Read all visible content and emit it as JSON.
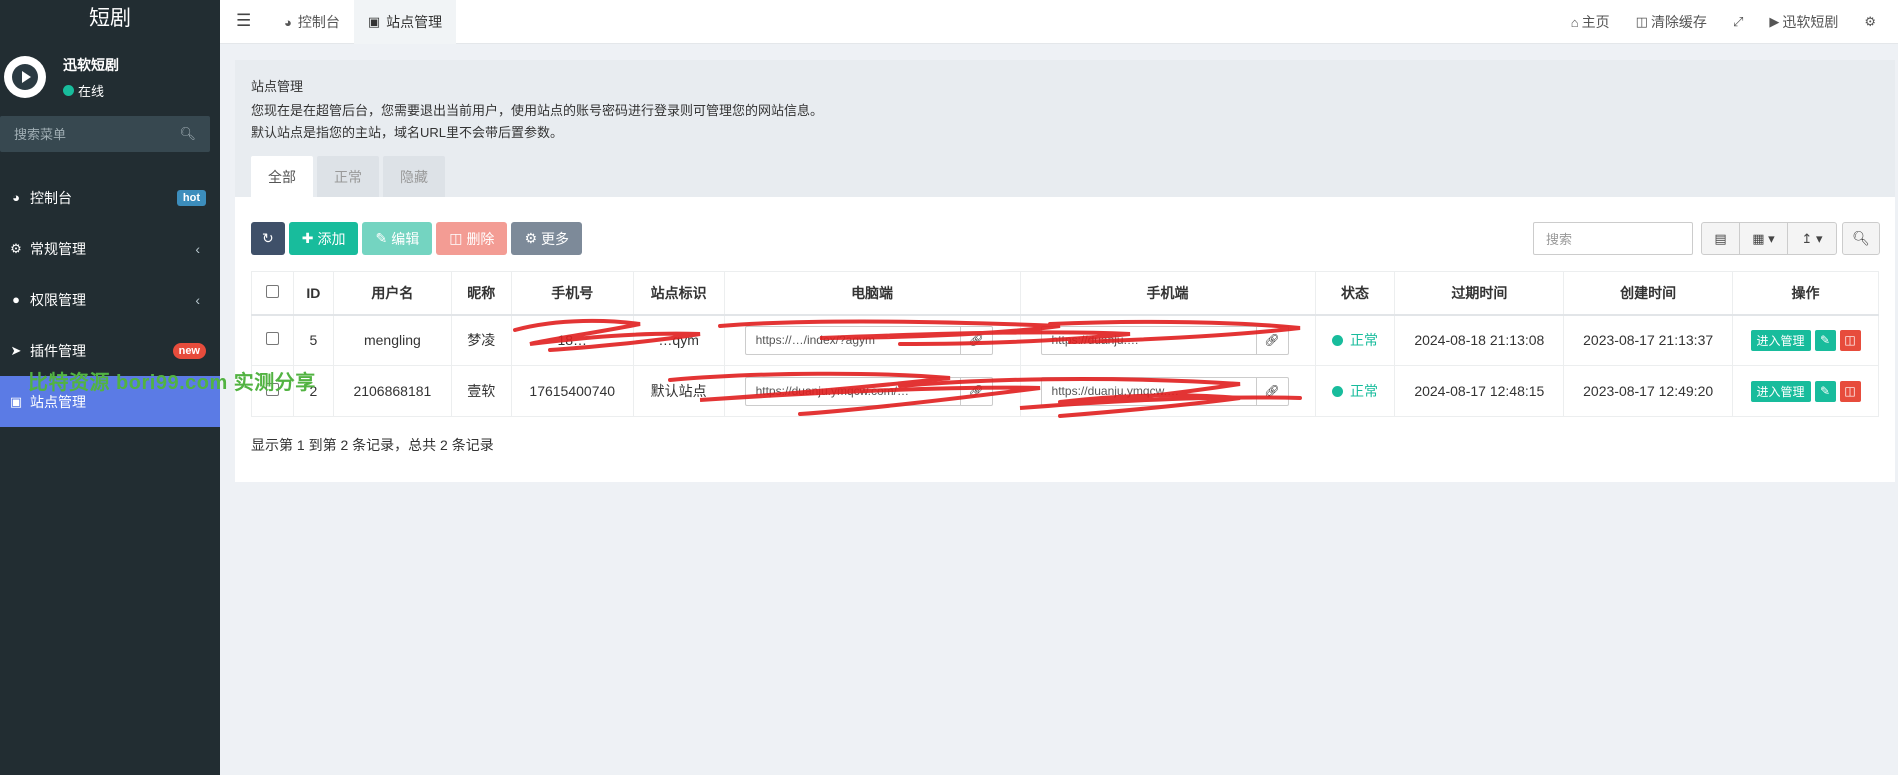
{
  "sidebar": {
    "brand": "短剧",
    "user": {
      "name": "迅软短剧",
      "status": "在线"
    },
    "search_placeholder": "搜索菜单",
    "items": [
      {
        "label": "控制台",
        "badge": "hot"
      },
      {
        "label": "常规管理"
      },
      {
        "label": "权限管理"
      },
      {
        "label": "插件管理",
        "badge": "new"
      },
      {
        "label": "站点管理"
      }
    ]
  },
  "watermark": "比特资源 bori99.com 实测分享",
  "topbar": {
    "tabs": [
      {
        "label": "控制台"
      },
      {
        "label": "站点管理"
      }
    ],
    "links": {
      "home": "主页",
      "clear_cache": "清除缓存",
      "user": "迅软短剧"
    }
  },
  "panel": {
    "title": "站点管理",
    "desc_line1": "您现在是在超管后台，您需要退出当前用户，使用站点的账号密码进行登录则可管理您的网站信息。",
    "desc_line2": "默认站点是指您的主站，域名URL里不会带后置参数。",
    "tabs": [
      "全部",
      "正常",
      "隐藏"
    ],
    "toolbar": {
      "add": "添加",
      "edit": "编辑",
      "delete": "删除",
      "more": "更多"
    },
    "search_placeholder": "搜索",
    "table": {
      "headers": [
        "ID",
        "用户名",
        "昵称",
        "手机号",
        "站点标识",
        "电脑端",
        "手机端",
        "状态",
        "过期时间",
        "创建时间",
        "操作"
      ],
      "rows": [
        {
          "id": "5",
          "username": "mengling",
          "nickname": "梦凌",
          "phone": "18…",
          "site": "…qym",
          "pc": "https://…/index/?agym",
          "mobile": "https://duanju.…",
          "status": "正常",
          "expire": "2024-08-18 21:13:08",
          "created": "2023-08-17 21:13:37",
          "manage": "进入管理"
        },
        {
          "id": "2",
          "username": "2106868181",
          "nickname": "壹软",
          "phone": "17615400740",
          "site": "默认站点",
          "pc": "https://duanju.ymqcw.com/…",
          "mobile": "https://duanju.ymqcw.…",
          "status": "正常",
          "expire": "2024-08-17 12:48:15",
          "created": "2023-08-17 12:49:20",
          "manage": "进入管理"
        }
      ]
    },
    "pager": "显示第 1 到第 2 条记录，总共 2 条记录"
  },
  "colors": {
    "accent": "#18bc9c",
    "sidebar": "#222d32",
    "active": "#5b7be5",
    "danger": "#e74c3c"
  }
}
